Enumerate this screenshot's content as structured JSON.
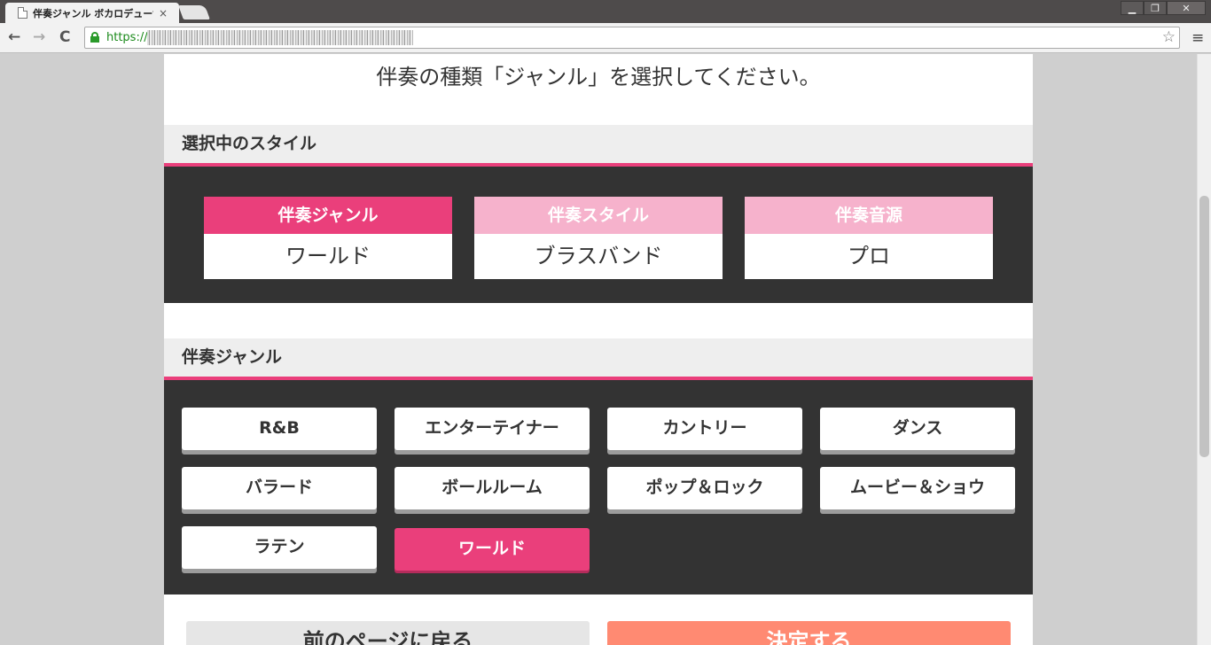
{
  "browser": {
    "tab_title": "伴奏ジャンル ボカロデューサ",
    "tab_close": "×",
    "url_scheme": "https://",
    "back": "←",
    "forward": "→",
    "reload": "C",
    "star": "☆",
    "menu": "≡",
    "win_minimize": "▁",
    "win_restore": "❐",
    "win_close": "✕"
  },
  "page": {
    "headline": "伴奏の種類「ジャンル」を選択してください。",
    "selected_section_title": "選択中のスタイル",
    "selected": [
      {
        "caption": "伴奏ジャンル",
        "value": "ワールド",
        "active": true
      },
      {
        "caption": "伴奏スタイル",
        "value": "ブラスバンド",
        "active": false
      },
      {
        "caption": "伴奏音源",
        "value": "プロ",
        "active": false
      }
    ],
    "genre_section_title": "伴奏ジャンル",
    "genres": [
      "R&B",
      "エンターテイナー",
      "カントリー",
      "ダンス",
      "バラード",
      "ボールルーム",
      "ポップ＆ロック",
      "ムービー＆ショウ",
      "ラテン",
      "ワールド"
    ],
    "selected_genre": "ワールド",
    "back_button": "前のページに戻る",
    "confirm_button": "決定する"
  },
  "colors": {
    "accent": "#ea3f7b",
    "accent_light": "#f6b2cc",
    "dark_panel": "#333333",
    "confirm": "#ff8a72"
  }
}
